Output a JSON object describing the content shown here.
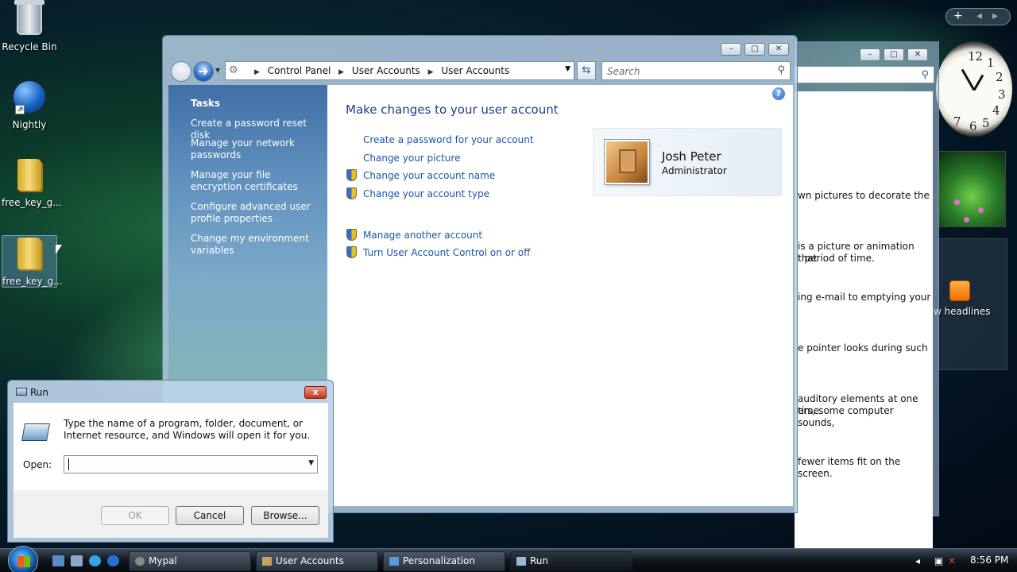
{
  "desktop": {
    "icons": [
      {
        "label": "Recycle Bin"
      },
      {
        "label": "Nightly"
      },
      {
        "label": "free_key_g..."
      },
      {
        "label": "free_key_g..."
      }
    ]
  },
  "control_panel": {
    "breadcrumb": [
      "Control Panel",
      "User Accounts",
      "User Accounts"
    ],
    "search_placeholder": "Search",
    "tasks_title": "Tasks",
    "tasks": [
      "Create a password reset disk",
      "Manage your network passwords",
      "Manage your file encryption certificates",
      "Configure advanced user profile properties",
      "Change my environment variables"
    ],
    "heading": "Make changes to your user account",
    "links": [
      {
        "label": "Create a password for your account",
        "shield": false
      },
      {
        "label": "Change your picture",
        "shield": false
      },
      {
        "label": "Change your account name",
        "shield": true
      },
      {
        "label": "Change your account type",
        "shield": true
      },
      {
        "label": "Manage another account",
        "shield": true
      },
      {
        "label": "Turn User Account Control on or off",
        "shield": true
      }
    ],
    "user": {
      "name": "Josh Peter",
      "role": "Administrator"
    },
    "help_label": "?"
  },
  "background_window": {
    "texts": [
      "wn pictures to decorate the",
      "is a picture or animation that",
      "t period of time.",
      "ing e-mail to emptying your",
      "e pointer looks during such",
      "auditory elements at one time",
      "ers, some computer sounds,",
      "fewer items fit on the screen."
    ]
  },
  "gadgets": {
    "clock_numbers": [
      "12",
      "1",
      "2",
      "3",
      "4",
      "5",
      "6",
      "7"
    ],
    "feed_text": "w headlines",
    "sidebar_add": "+"
  },
  "run_dialog": {
    "title": "Run",
    "description": "Type the name of a program, folder, document, or Internet resource, and Windows will open it for you.",
    "open_label": "Open:",
    "open_value": "",
    "buttons": {
      "ok": "OK",
      "cancel": "Cancel",
      "browse": "Browse..."
    },
    "close_label": "x"
  },
  "taskbar": {
    "buttons": [
      {
        "label": "Mypal"
      },
      {
        "label": "User Accounts"
      },
      {
        "label": "Personalization"
      },
      {
        "label": "Run"
      }
    ],
    "time": "8:56 PM"
  },
  "colors": {
    "link": "#1a55a8",
    "heading": "#1f3d84"
  }
}
